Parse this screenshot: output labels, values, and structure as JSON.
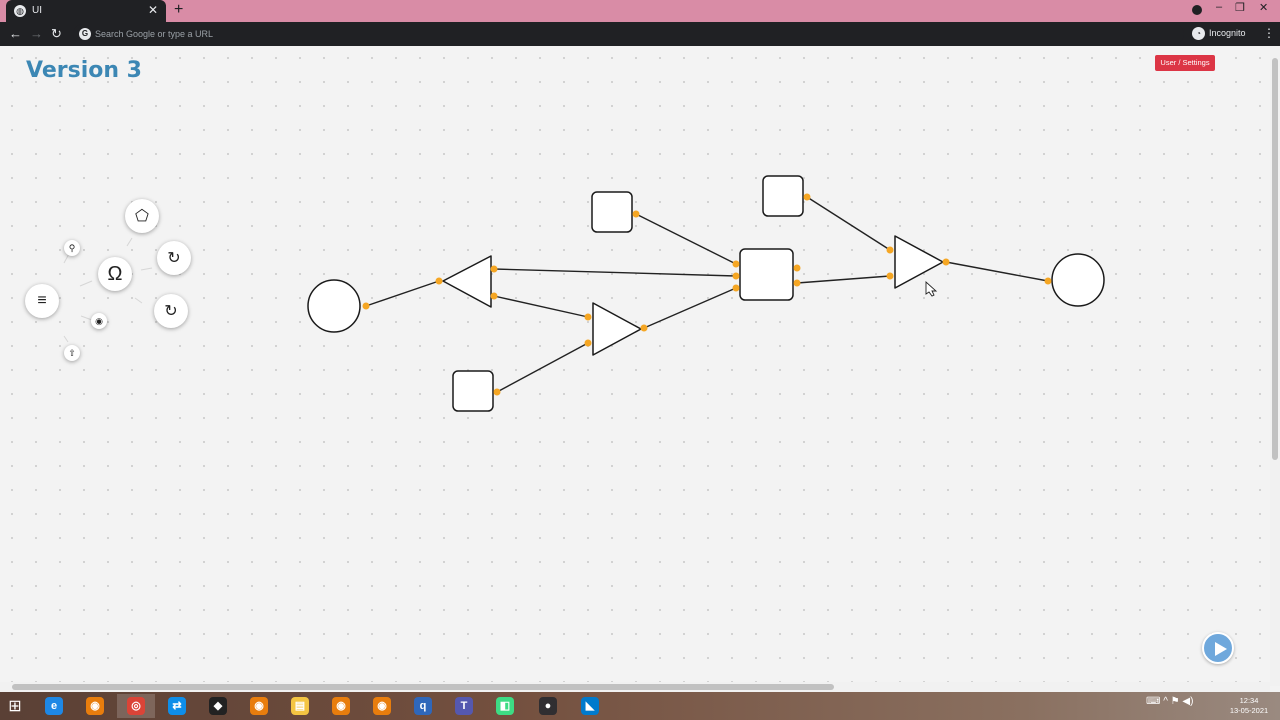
{
  "browser": {
    "tab_title": "UI",
    "tab_favicon": "globe-icon",
    "close_glyph": "✕",
    "newtab_glyph": "+",
    "omnibox_placeholder": "Search Google or type a URL",
    "incognito_label": "Incognito",
    "window_controls": {
      "minimize": "–",
      "restore": "❐",
      "close": "✕"
    },
    "nav": {
      "back": "←",
      "forward": "→",
      "reload": "↻"
    },
    "menu_glyph": "⋮"
  },
  "page": {
    "title": "Version 3",
    "user_settings_label": "User / Settings"
  },
  "radial_menu": {
    "center_icon": "hamburger-menu-icon",
    "center_glyph": "≡",
    "omega_glyph": "Ω",
    "pentagon_glyph": "⬠",
    "rotate_glyph": "↻",
    "rotate2_glyph": "↻",
    "wrench_glyph": "⚲",
    "palette_glyph": "◉",
    "upload_glyph": "⇧"
  },
  "graph": {
    "port_color": "#f5a623",
    "stroke_color": "#222222",
    "nodes": [
      "circle",
      "triangle-left",
      "square",
      "triangle-right",
      "square",
      "square",
      "square",
      "triangle-right",
      "circle"
    ]
  },
  "taskbar": {
    "start_glyph": "⊞",
    "apps": [
      {
        "name": "edge",
        "glyph": "e",
        "color": "#1e88e5"
      },
      {
        "name": "blender",
        "glyph": "◉",
        "color": "#e87d0d"
      },
      {
        "name": "chrome",
        "glyph": "◎",
        "color": "#db4437"
      },
      {
        "name": "teamviewer",
        "glyph": "⇄",
        "color": "#0e8ee9"
      },
      {
        "name": "unity",
        "glyph": "◆",
        "color": "#222222"
      },
      {
        "name": "blender-2",
        "glyph": "◉",
        "color": "#e87d0d"
      },
      {
        "name": "file-explorer",
        "glyph": "▤",
        "color": "#f4c542"
      },
      {
        "name": "blender-3",
        "glyph": "◉",
        "color": "#e87d0d"
      },
      {
        "name": "blender-4",
        "glyph": "◉",
        "color": "#e87d0d"
      },
      {
        "name": "qbittorrent",
        "glyph": "q",
        "color": "#2f67ba"
      },
      {
        "name": "teams",
        "glyph": "T",
        "color": "#5558af"
      },
      {
        "name": "android-studio",
        "glyph": "◧",
        "color": "#3ddc84"
      },
      {
        "name": "obs",
        "glyph": "●",
        "color": "#302e31"
      },
      {
        "name": "vscode",
        "glyph": "◣",
        "color": "#007acc"
      }
    ],
    "tray_glyphs": "⌨ ^ ⚑ ◀)",
    "clock_time": "12:34",
    "clock_date": "13-05-2021"
  }
}
